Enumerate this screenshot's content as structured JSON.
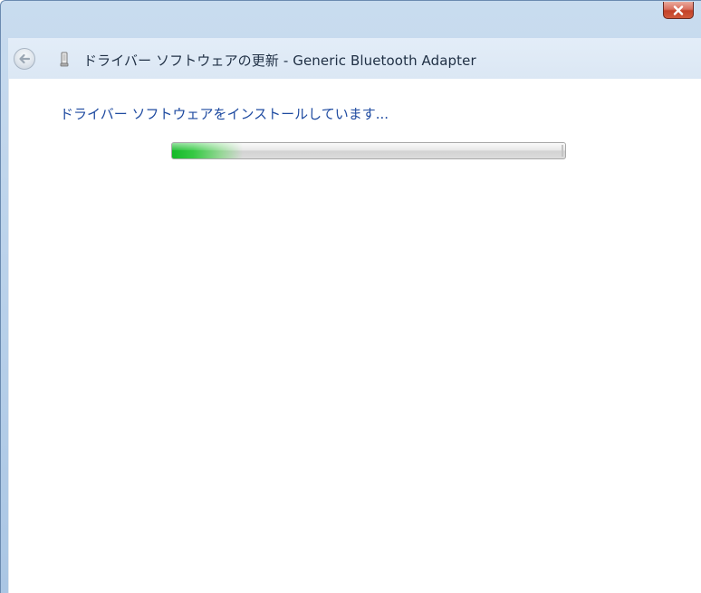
{
  "window": {
    "title": "ドライバー ソフトウェアの更新 - Generic Bluetooth Adapter"
  },
  "icons": {
    "close": "close-icon",
    "back": "back-arrow-icon",
    "device": "bluetooth-adapter-icon"
  },
  "content": {
    "status": "ドライバー ソフトウェアをインストールしています...",
    "progress_percent": 18
  },
  "colors": {
    "status_text": "#1e4aa0",
    "progress_green": "#14b928",
    "close_button": "#c34128"
  }
}
